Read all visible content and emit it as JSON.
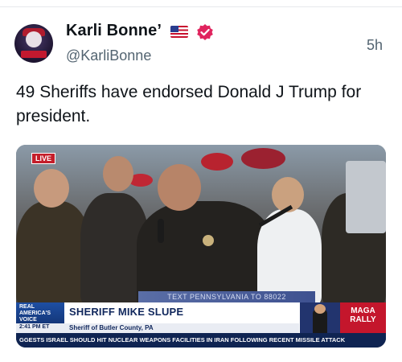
{
  "post": {
    "author_name": "Karli Bonne’",
    "handle": "@KarliBonne",
    "time_ago": "5h",
    "text": "49 Sheriffs have endorsed Donald J Trump for president.",
    "icons": [
      "us-flag-icon",
      "verified-badge-icon"
    ]
  },
  "media": {
    "live_label": "LIVE",
    "top_banner": "TEXT PENNSYLVANIA TO 88022",
    "network_logo": [
      "REAL",
      "AMERICA'S",
      "VOICE"
    ],
    "lower_third_name": "SHERIFF MIKE SLUPE",
    "lower_third_time": "2:41 PM ET",
    "lower_third_subtitle": "Sheriff of Butler County, PA",
    "side_graphic": [
      "MAGA",
      "RALLY"
    ],
    "ticker": "GGESTS ISRAEL SHOULD HIT NUCLEAR WEAPONS FACILITIES IN IRAN FOLLOWING RECENT MISSILE ATTACK"
  }
}
